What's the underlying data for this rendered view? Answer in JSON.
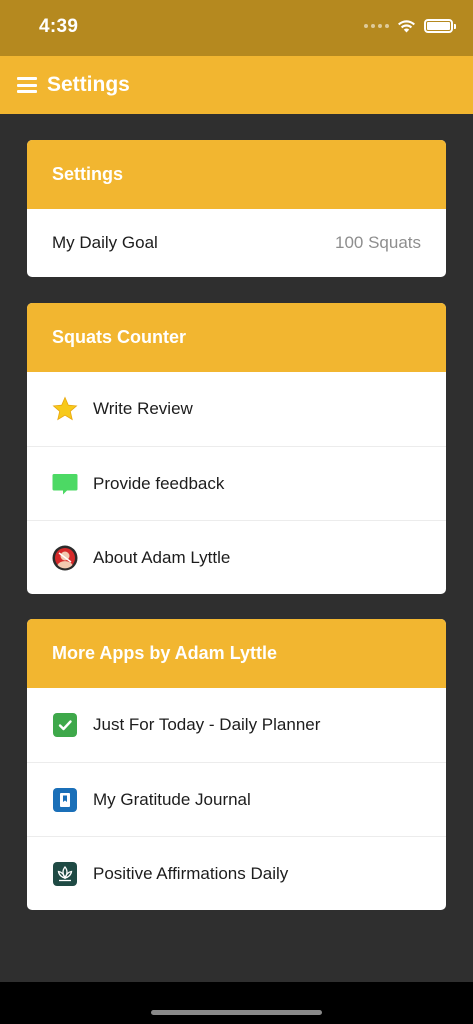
{
  "status_bar": {
    "time": "4:39"
  },
  "nav": {
    "title": "Settings"
  },
  "settings_card": {
    "header": "Settings",
    "goal_label": "My Daily Goal",
    "goal_value": "100 Squats"
  },
  "app_card": {
    "header": "Squats Counter",
    "items": [
      {
        "label": "Write Review",
        "icon": "star-icon"
      },
      {
        "label": "Provide feedback",
        "icon": "chat-bubble-icon"
      },
      {
        "label": "About Adam Lyttle",
        "icon": "avatar-icon"
      }
    ]
  },
  "more_apps_card": {
    "header": "More Apps by Adam Lyttle",
    "items": [
      {
        "label": "Just For Today - Daily Planner",
        "icon": "checkmark-app-icon"
      },
      {
        "label": "My Gratitude Journal",
        "icon": "journal-app-icon"
      },
      {
        "label": "Positive Affirmations Daily",
        "icon": "lotus-app-icon"
      }
    ]
  },
  "colors": {
    "accent": "#f2b630",
    "status_bar": "#b5891f",
    "background": "#2f2f2f",
    "feedback_green": "#4cd964",
    "planner_green": "#3ea84a",
    "journal_blue": "#1a6fb8",
    "lotus_dark": "#1f4a44"
  }
}
